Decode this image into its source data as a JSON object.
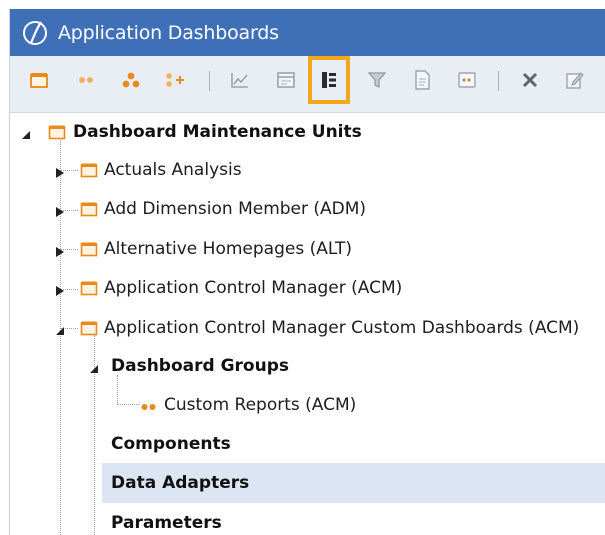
{
  "window": {
    "title": "Application Dashboards"
  },
  "toolbar": {
    "buttons": [
      {
        "name": "new-maintenance-unit-button",
        "icon": "calendar-folder-icon"
      },
      {
        "name": "new-group-button",
        "icon": "two-dots-icon"
      },
      {
        "name": "new-profile-button",
        "icon": "three-dots-icon"
      },
      {
        "name": "add-group-button",
        "icon": "dots-plus-icon"
      },
      {
        "name": "new-chart-button",
        "icon": "chart-icon"
      },
      {
        "name": "new-dashboard-button",
        "icon": "window-icon"
      },
      {
        "name": "new-component-button",
        "icon": "component-icon",
        "highlighted": true
      },
      {
        "name": "new-filter-button",
        "icon": "funnel-icon"
      },
      {
        "name": "new-file-button",
        "icon": "document-icon"
      },
      {
        "name": "new-parameter-button",
        "icon": "parameter-icon"
      },
      {
        "name": "delete-button",
        "icon": "x-icon"
      },
      {
        "name": "rename-button",
        "icon": "edit-icon"
      }
    ],
    "highlight_color": "#f2a81d"
  },
  "tree": {
    "root": {
      "label": "Dashboard Maintenance Units"
    },
    "units": [
      {
        "label": "Actuals Analysis"
      },
      {
        "label": "Add Dimension Member (ADM)"
      },
      {
        "label": "Alternative Homepages (ALT)"
      },
      {
        "label": "Application Control Manager (ACM)"
      },
      {
        "label": "Application Control Manager Custom Dashboards (ACM)"
      }
    ],
    "children": {
      "dashboard_groups": "Dashboard Groups",
      "custom_reports": "Custom Reports (ACM)",
      "components": "Components",
      "data_adapters": "Data Adapters",
      "parameters": "Parameters"
    },
    "selected": "Data Adapters"
  },
  "colors": {
    "titlebar": "#3e6fb7",
    "toolbar": "#e9eef5",
    "icon_orange": "#e8891c",
    "selection": "#dbe5f3"
  }
}
